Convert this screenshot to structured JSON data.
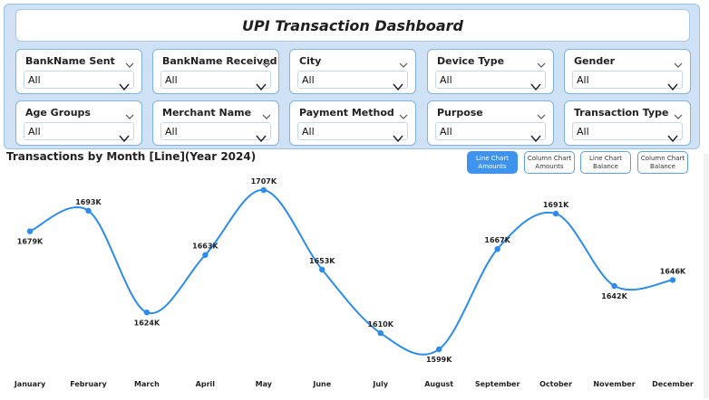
{
  "dashboard": {
    "title": "UPI Transaction Dashboard"
  },
  "slicers": [
    {
      "label": "BankName Sent",
      "value": "All"
    },
    {
      "label": "BankName Received",
      "value": "All"
    },
    {
      "label": "City",
      "value": "All"
    },
    {
      "label": "Device Type",
      "value": "All"
    },
    {
      "label": "Gender",
      "value": "All"
    },
    {
      "label": "Age Groups",
      "value": "All"
    },
    {
      "label": "Merchant Name",
      "value": "All"
    },
    {
      "label": "Payment Method",
      "value": "All"
    },
    {
      "label": "Purpose",
      "value": "All"
    },
    {
      "label": "Transaction Type",
      "value": "All"
    }
  ],
  "chart_buttons": [
    {
      "label": "Line Chart Amounts",
      "active": true
    },
    {
      "label": "Column Chart Amounts",
      "active": false
    },
    {
      "label": "Line Chart Balance",
      "active": false
    },
    {
      "label": "Column Chart Balance",
      "active": false
    }
  ],
  "colors": {
    "accent": "#3e94ec",
    "line": "#2b8cee",
    "panel": "#cfe2f5"
  },
  "chart_data": {
    "type": "line",
    "title": "Transactions by Month [Line](Year 2024)",
    "categories": [
      "January",
      "February",
      "March",
      "April",
      "May",
      "June",
      "July",
      "August",
      "September",
      "October",
      "November",
      "December"
    ],
    "series": [
      {
        "values": [
          1679,
          1693,
          1624,
          1663,
          1707,
          1653,
          1610,
          1599,
          1667,
          1691,
          1642,
          1646
        ],
        "labels": [
          "1679K",
          "1693K",
          "1624K",
          "1663K",
          "1707K",
          "1653K",
          "1610K",
          "1599K",
          "1667K",
          "1691K",
          "1642K",
          "1646K"
        ]
      }
    ],
    "grid": false,
    "legend": "none"
  }
}
